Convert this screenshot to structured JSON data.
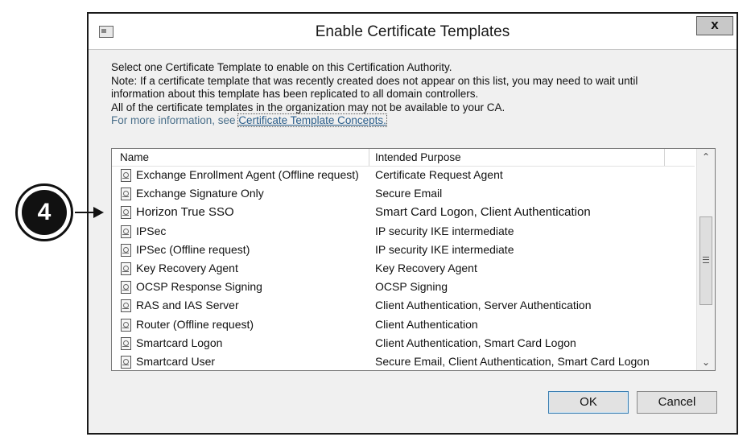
{
  "dialog": {
    "title": "Enable Certificate Templates",
    "close_label": "x",
    "description": [
      "Select one Certificate Template to enable on this Certification Authority.",
      "Note: If a certificate template that was recently created does not appear on this list, you may need to wait until",
      "information about this template has been replicated to all domain controllers.",
      "All of the certificate templates in the organization may not be available to your CA."
    ],
    "info_prefix": "For more information, see ",
    "info_link": "Certificate Template Concepts."
  },
  "list": {
    "columns": [
      "Name",
      "Intended Purpose"
    ],
    "rows": [
      {
        "name": "Exchange Enrollment Agent (Offline request)",
        "purpose": "Certificate Request Agent"
      },
      {
        "name": "Exchange Signature Only",
        "purpose": "Secure Email"
      },
      {
        "name": "Horizon True SSO",
        "purpose": "Smart Card Logon, Client Authentication"
      },
      {
        "name": "IPSec",
        "purpose": "IP security IKE intermediate"
      },
      {
        "name": "IPSec (Offline request)",
        "purpose": "IP security IKE intermediate"
      },
      {
        "name": "Key Recovery Agent",
        "purpose": "Key Recovery Agent"
      },
      {
        "name": "OCSP Response Signing",
        "purpose": "OCSP Signing"
      },
      {
        "name": "RAS and IAS Server",
        "purpose": "Client Authentication, Server Authentication"
      },
      {
        "name": "Router (Offline request)",
        "purpose": "Client Authentication"
      },
      {
        "name": "Smartcard Logon",
        "purpose": "Client Authentication, Smart Card Logon"
      },
      {
        "name": "Smartcard User",
        "purpose": "Secure Email, Client Authentication, Smart Card Logon"
      }
    ],
    "scroll_up_icon": "chevron-up-icon",
    "scroll_down_icon": "chevron-down-icon"
  },
  "buttons": {
    "ok": "OK",
    "cancel": "Cancel"
  },
  "callout": {
    "number": "4"
  }
}
